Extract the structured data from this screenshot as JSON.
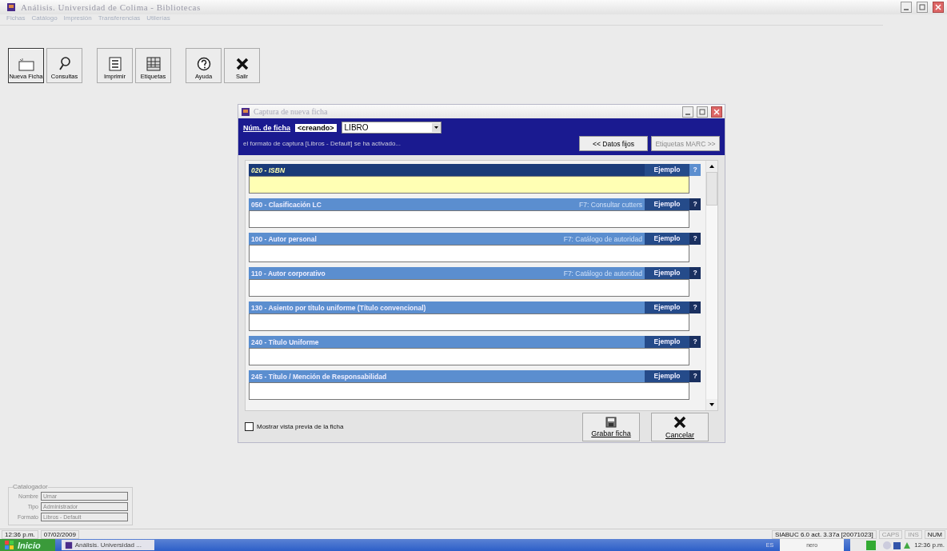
{
  "window": {
    "title": "Análisis. Universidad de Colima - Bibliotecas"
  },
  "menu": [
    "Fichas",
    "Catálogo",
    "Impresión",
    "Transferencias",
    "Utilerías"
  ],
  "toolbar": [
    {
      "label": "Nueva Ficha",
      "selected": true
    },
    {
      "label": "Consultas",
      "selected": false
    },
    {
      "label": "Imprimir",
      "selected": false
    },
    {
      "label": "Etiquetas",
      "selected": false
    },
    {
      "label": "Ayuda",
      "selected": false
    },
    {
      "label": "Salir",
      "selected": false
    }
  ],
  "dialog": {
    "title": "Captura de nueva ficha",
    "record_label": "Núm. de ficha",
    "record_value": "<creando>",
    "type_value": "LIBRO",
    "message": "el formato de captura [Libros - Default] se ha activado...",
    "buttons": [
      {
        "label": "<< Datos fijos",
        "disabled": false
      },
      {
        "label": "Etiquetas MARC >>",
        "disabled": true
      }
    ],
    "fields": [
      {
        "label": "020 - ISBN",
        "example_label": "Ejemplo",
        "help_label": "?",
        "selected": true
      },
      {
        "label": "050 - Clasificación LC",
        "hint": "F7: Consultar cutters",
        "example_label": "Ejemplo",
        "help_label": "?",
        "selected": false
      },
      {
        "label": "100 - Autor personal",
        "hint": "F7: Catálogo de autoridad",
        "example_label": "Ejemplo",
        "help_label": "?",
        "selected": false
      },
      {
        "label": "110 - Autor corporativo",
        "hint": "F7: Catálogo de autoridad",
        "example_label": "Ejemplo",
        "help_label": "?",
        "selected": false
      },
      {
        "label": "130 - Asiento por título uniforme (Título convencional)",
        "example_label": "Ejemplo",
        "help_label": "?",
        "selected": false
      },
      {
        "label": "240 - Título Uniforme",
        "example_label": "Ejemplo",
        "help_label": "?",
        "selected": false
      },
      {
        "label": "245 - Título / Mención de Responsabilidad",
        "example_label": "Ejemplo",
        "help_label": "?",
        "selected": false
      }
    ],
    "preview_checkbox": {
      "label": "Mostrar vista previa de la ficha",
      "checked": false
    },
    "save_button": "Grabar ficha",
    "cancel_button": "Cancelar"
  },
  "cataloger": {
    "title": "Catalogador",
    "rows": [
      {
        "label": "Nombre",
        "value": "Umar"
      },
      {
        "label": "Tipo",
        "value": "Administrador"
      },
      {
        "label": "Formato",
        "value": "Libros - Default"
      }
    ]
  },
  "status_bar": {
    "time": "12:36 p.m.",
    "date": "07/02/2009",
    "version": "SIABUC 6.0 act. 3.37a [20071023]",
    "keys": [
      {
        "label": "CAPS",
        "on": false
      },
      {
        "label": "INS",
        "on": false
      },
      {
        "label": "NUM",
        "on": true
      }
    ]
  },
  "taskbar": {
    "start": "Inicio",
    "task": "Análisis. Universidad ...",
    "language": "ES",
    "tray_logo": "nero",
    "clock": "12:36 p.m."
  }
}
